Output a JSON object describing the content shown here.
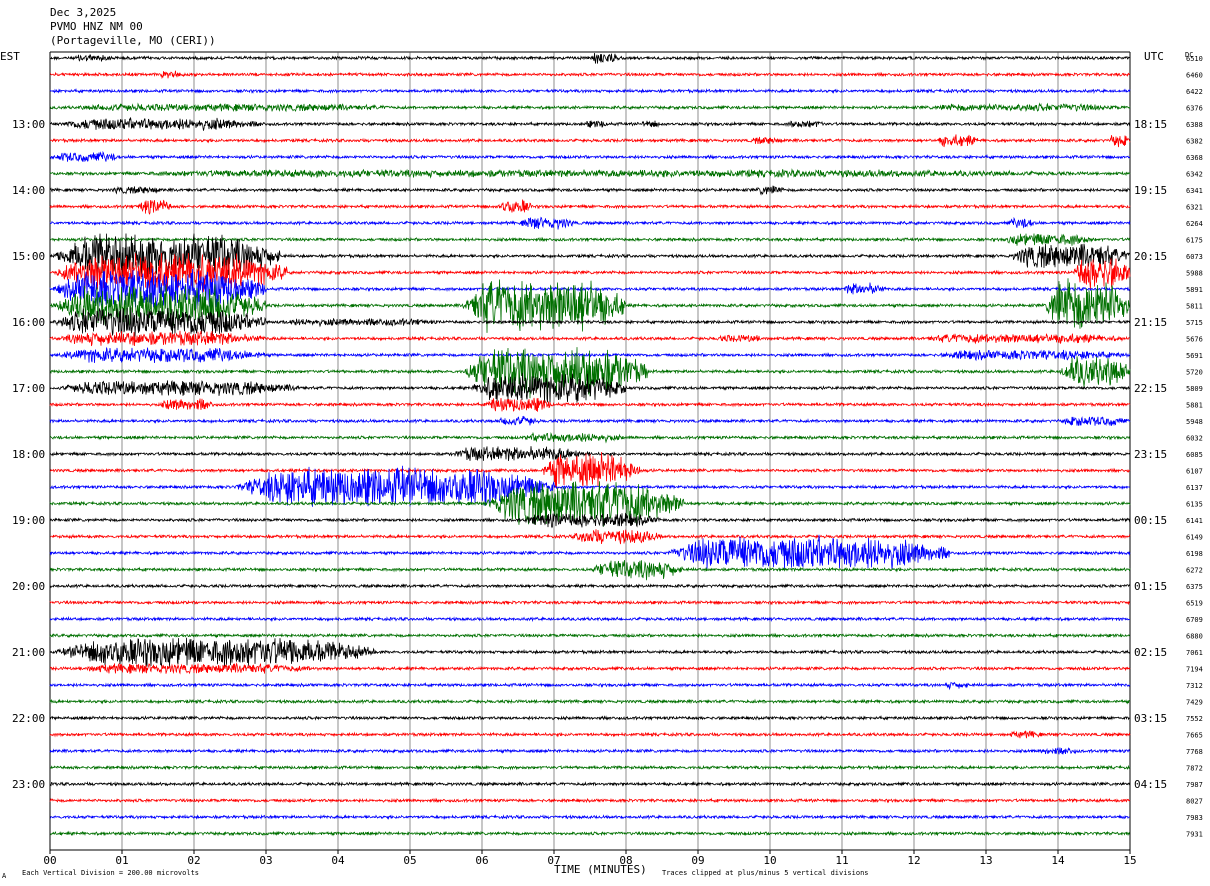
{
  "header": {
    "date": "Dec 3,2025",
    "station": "PVMO HNZ NM 00",
    "location": "(Portageville, MO (CERI))"
  },
  "chart_data": {
    "type": "line",
    "title": "PVMO HNZ NM 00",
    "left_axis_label": "EST",
    "right_axis_label": "UTC",
    "dc_header": "DC",
    "xlabel": "TIME (MINUTES)",
    "xlim": [
      0,
      15
    ],
    "x_ticks": [
      "00",
      "01",
      "02",
      "03",
      "04",
      "05",
      "06",
      "07",
      "08",
      "09",
      "10",
      "11",
      "12",
      "13",
      "14",
      "15"
    ],
    "trace_colors": [
      "#000000",
      "#ff0000",
      "#0000ff",
      "#007000"
    ],
    "grid": true,
    "left_hour_labels": [
      {
        "row": 4,
        "text": "13:00"
      },
      {
        "row": 8,
        "text": "14:00"
      },
      {
        "row": 12,
        "text": "15:00"
      },
      {
        "row": 16,
        "text": "16:00"
      },
      {
        "row": 20,
        "text": "17:00"
      },
      {
        "row": 24,
        "text": "18:00"
      },
      {
        "row": 28,
        "text": "19:00"
      },
      {
        "row": 32,
        "text": "20:00"
      },
      {
        "row": 36,
        "text": "21:00"
      },
      {
        "row": 40,
        "text": "22:00"
      },
      {
        "row": 44,
        "text": "23:00"
      }
    ],
    "right_hour_labels": [
      {
        "row": 4,
        "text": "18:15"
      },
      {
        "row": 8,
        "text": "19:15"
      },
      {
        "row": 12,
        "text": "20:15"
      },
      {
        "row": 16,
        "text": "21:15"
      },
      {
        "row": 20,
        "text": "22:15"
      },
      {
        "row": 24,
        "text": "23:15"
      },
      {
        "row": 28,
        "text": "00:15"
      },
      {
        "row": 32,
        "text": "01:15"
      },
      {
        "row": 36,
        "text": "02:15"
      },
      {
        "row": 40,
        "text": "03:15"
      },
      {
        "row": 44,
        "text": "04:15"
      }
    ],
    "dc_offsets": [
      "6510",
      "6460",
      "6422",
      "6376",
      "6388",
      "6382",
      "6368",
      "6342",
      "6341",
      "6321",
      "6264",
      "6175",
      "6073",
      "5988",
      "5891",
      "5811",
      "5715",
      "5676",
      "5691",
      "5720",
      "5809",
      "5881",
      "5948",
      "6032",
      "6085",
      "6107",
      "6137",
      "6135",
      "6141",
      "6149",
      "6198",
      "6272",
      "6375",
      "6519",
      "6709",
      "6880",
      "7061",
      "7194",
      "7312",
      "7429",
      "7552",
      "7665",
      "7768",
      "7872",
      "7987",
      "8027",
      "7983",
      "7931"
    ],
    "noise_level": 1.2,
    "events": [
      {
        "row": 0,
        "start": 0.3,
        "end": 0.9,
        "amp": 3
      },
      {
        "row": 0,
        "start": 7.5,
        "end": 7.9,
        "amp": 5
      },
      {
        "row": 1,
        "start": 1.5,
        "end": 1.9,
        "amp": 3
      },
      {
        "row": 3,
        "start": 0.0,
        "end": 5.0,
        "amp": 3
      },
      {
        "row": 3,
        "start": 12.0,
        "end": 15.0,
        "amp": 3
      },
      {
        "row": 4,
        "start": 0.0,
        "end": 3.0,
        "amp": 5
      },
      {
        "row": 4,
        "start": 7.4,
        "end": 7.8,
        "amp": 3
      },
      {
        "row": 4,
        "start": 8.2,
        "end": 8.5,
        "amp": 3
      },
      {
        "row": 4,
        "start": 10.2,
        "end": 10.8,
        "amp": 3
      },
      {
        "row": 5,
        "start": 9.7,
        "end": 10.2,
        "amp": 3
      },
      {
        "row": 5,
        "start": 12.3,
        "end": 12.9,
        "amp": 5
      },
      {
        "row": 5,
        "start": 14.7,
        "end": 15.0,
        "amp": 5
      },
      {
        "row": 6,
        "start": 0.0,
        "end": 1.0,
        "amp": 4
      },
      {
        "row": 7,
        "start": 0.0,
        "end": 15.0,
        "amp": 3
      },
      {
        "row": 8,
        "start": 0.8,
        "end": 1.6,
        "amp": 3
      },
      {
        "row": 8,
        "start": 9.8,
        "end": 10.2,
        "amp": 4
      },
      {
        "row": 9,
        "start": 1.2,
        "end": 1.7,
        "amp": 6
      },
      {
        "row": 9,
        "start": 6.2,
        "end": 6.7,
        "amp": 6
      },
      {
        "row": 10,
        "start": 6.5,
        "end": 7.3,
        "amp": 5
      },
      {
        "row": 10,
        "start": 13.3,
        "end": 13.7,
        "amp": 4
      },
      {
        "row": 11,
        "start": 13.2,
        "end": 14.5,
        "amp": 5
      },
      {
        "row": 12,
        "start": 0.0,
        "end": 3.2,
        "amp": 18
      },
      {
        "row": 12,
        "start": 13.3,
        "end": 15.0,
        "amp": 10
      },
      {
        "row": 13,
        "start": 0.0,
        "end": 3.3,
        "amp": 16
      },
      {
        "row": 13,
        "start": 14.2,
        "end": 15.0,
        "amp": 14
      },
      {
        "row": 14,
        "start": 0.0,
        "end": 3.0,
        "amp": 16
      },
      {
        "row": 14,
        "start": 11.0,
        "end": 11.6,
        "amp": 5
      },
      {
        "row": 15,
        "start": 0.0,
        "end": 3.0,
        "amp": 16
      },
      {
        "row": 15,
        "start": 5.7,
        "end": 8.0,
        "amp": 22
      },
      {
        "row": 15,
        "start": 13.8,
        "end": 15.0,
        "amp": 22
      },
      {
        "row": 16,
        "start": 0.0,
        "end": 3.0,
        "amp": 12
      },
      {
        "row": 16,
        "start": 3.0,
        "end": 5.5,
        "amp": 3
      },
      {
        "row": 17,
        "start": 0.0,
        "end": 3.0,
        "amp": 6
      },
      {
        "row": 17,
        "start": 9.2,
        "end": 10.0,
        "amp": 3
      },
      {
        "row": 17,
        "start": 12.0,
        "end": 15.0,
        "amp": 4
      },
      {
        "row": 18,
        "start": 0.0,
        "end": 3.0,
        "amp": 6
      },
      {
        "row": 18,
        "start": 12.2,
        "end": 15.0,
        "amp": 4
      },
      {
        "row": 19,
        "start": 5.7,
        "end": 8.3,
        "amp": 20
      },
      {
        "row": 19,
        "start": 14.0,
        "end": 15.0,
        "amp": 12
      },
      {
        "row": 20,
        "start": 0.0,
        "end": 3.5,
        "amp": 6
      },
      {
        "row": 20,
        "start": 5.8,
        "end": 8.0,
        "amp": 12
      },
      {
        "row": 21,
        "start": 1.5,
        "end": 2.3,
        "amp": 5
      },
      {
        "row": 21,
        "start": 6.0,
        "end": 7.0,
        "amp": 6
      },
      {
        "row": 22,
        "start": 6.2,
        "end": 6.8,
        "amp": 4
      },
      {
        "row": 22,
        "start": 14.0,
        "end": 15.0,
        "amp": 4
      },
      {
        "row": 23,
        "start": 6.5,
        "end": 8.0,
        "amp": 4
      },
      {
        "row": 24,
        "start": 5.5,
        "end": 7.5,
        "amp": 6
      },
      {
        "row": 25,
        "start": 6.8,
        "end": 8.2,
        "amp": 14
      },
      {
        "row": 26,
        "start": 2.5,
        "end": 7.0,
        "amp": 16
      },
      {
        "row": 27,
        "start": 6.0,
        "end": 8.8,
        "amp": 18
      },
      {
        "row": 28,
        "start": 6.5,
        "end": 8.5,
        "amp": 6
      },
      {
        "row": 29,
        "start": 7.2,
        "end": 8.5,
        "amp": 6
      },
      {
        "row": 30,
        "start": 8.5,
        "end": 12.5,
        "amp": 14
      },
      {
        "row": 31,
        "start": 7.5,
        "end": 8.8,
        "amp": 8
      },
      {
        "row": 36,
        "start": 0.0,
        "end": 4.5,
        "amp": 12
      },
      {
        "row": 37,
        "start": 0.2,
        "end": 3.8,
        "amp": 4
      },
      {
        "row": 38,
        "start": 12.4,
        "end": 12.8,
        "amp": 3
      },
      {
        "row": 41,
        "start": 13.3,
        "end": 13.8,
        "amp": 3
      },
      {
        "row": 42,
        "start": 13.7,
        "end": 14.3,
        "amp": 3
      }
    ]
  },
  "footer": {
    "scale_note": "Each Vertical Division =  200.00 microvolts",
    "clip_note": "Traces clipped at plus/minus 5 vertical divisions",
    "corner_mark": "A"
  }
}
